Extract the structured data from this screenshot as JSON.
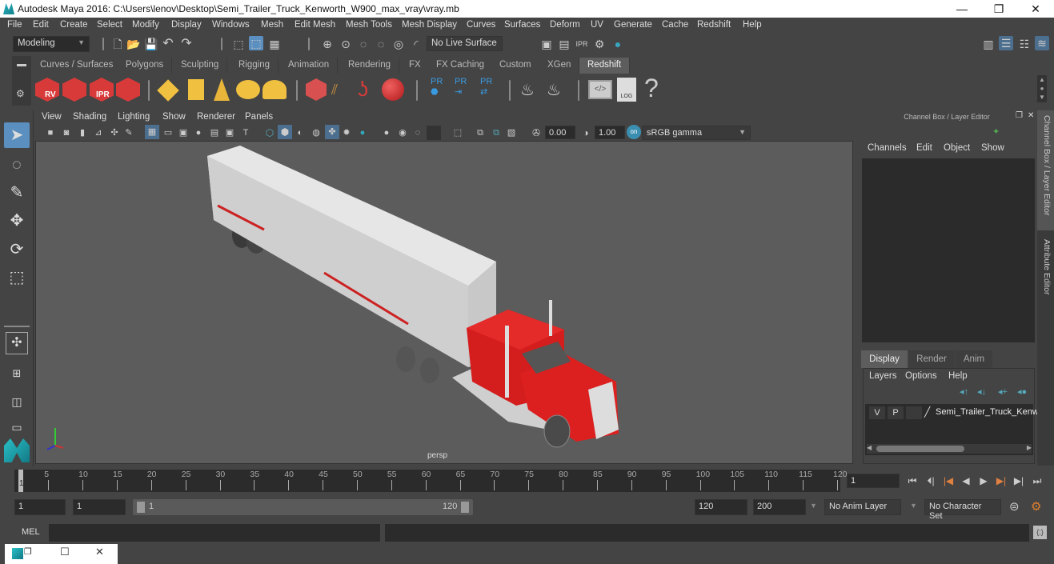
{
  "window": {
    "title": "Autodesk Maya 2016: C:\\Users\\lenov\\Desktop\\Semi_Trailer_Truck_Kenworth_W900_max_vray\\vray.mb",
    "minimize": "—",
    "restore": "❐",
    "close": "✕"
  },
  "menubar": [
    "File",
    "Edit",
    "Create",
    "Select",
    "Modify",
    "Display",
    "Windows",
    "Mesh",
    "Edit Mesh",
    "Mesh Tools",
    "Mesh Display",
    "Curves",
    "Surfaces",
    "Deform",
    "UV",
    "Generate",
    "Cache",
    "Redshift",
    "Help"
  ],
  "statusline": {
    "mode": "Modeling",
    "live_surface": "No Live Surface"
  },
  "shelf": {
    "tabs": [
      "Curves / Surfaces",
      "Polygons",
      "Sculpting",
      "Rigging",
      "Animation",
      "Rendering",
      "FX",
      "FX Caching",
      "Custom",
      "XGen",
      "Redshift"
    ],
    "active_tab": "Redshift",
    "icons": [
      {
        "name": "redshift-render-view-icon",
        "label": "RV"
      },
      {
        "name": "redshift-render-sequence-icon",
        "label": ""
      },
      {
        "name": "redshift-ipr-icon",
        "label": "IPR"
      },
      {
        "name": "redshift-settings-icon",
        "label": ""
      },
      {
        "name": "rs-light-diamond-icon",
        "label": ""
      },
      {
        "name": "rs-area-light-icon",
        "label": ""
      },
      {
        "name": "rs-spot-light-icon",
        "label": ""
      },
      {
        "name": "rs-dome-light-icon",
        "label": ""
      },
      {
        "name": "rs-sun-sky-icon",
        "label": ""
      },
      {
        "name": "rs-proxy-icon",
        "label": ""
      },
      {
        "name": "rs-hair-icon",
        "label": ""
      },
      {
        "name": "rs-volume-icon",
        "label": ""
      },
      {
        "name": "rs-material-sphere-icon",
        "label": ""
      },
      {
        "name": "pr-object-icon",
        "label": "PR"
      },
      {
        "name": "pr-export-icon",
        "label": "PR"
      },
      {
        "name": "pr-swap-icon",
        "label": "PR"
      },
      {
        "name": "bake-multiple-icon",
        "label": ""
      },
      {
        "name": "bake-single-icon",
        "label": ""
      },
      {
        "name": "script-editor-icon",
        "label": ""
      },
      {
        "name": "log-icon",
        "label": "LOG"
      },
      {
        "name": "help-icon",
        "label": "?"
      }
    ]
  },
  "viewport": {
    "menu": [
      "View",
      "Shading",
      "Lighting",
      "Show",
      "Renderer",
      "Panels"
    ],
    "exposure": "0.00",
    "gamma": "1.00",
    "color_space": "sRGB gamma",
    "camera_label": "persp"
  },
  "channel_box": {
    "title": "Channel Box / Layer Editor",
    "menu": [
      "Channels",
      "Edit",
      "Object",
      "Show"
    ],
    "layer_tabs": [
      "Display",
      "Render",
      "Anim"
    ],
    "active_layer_tab": "Display",
    "layer_menu": [
      "Layers",
      "Options",
      "Help"
    ],
    "layers": [
      {
        "v": "V",
        "p": "P",
        "name": "Semi_Trailer_Truck_Kenw"
      }
    ]
  },
  "side_tabs": [
    "Channel Box / Layer Editor",
    "Attribute Editor"
  ],
  "timeline": {
    "ticks": [
      5,
      10,
      15,
      20,
      25,
      30,
      35,
      40,
      45,
      50,
      55,
      60,
      65,
      70,
      75,
      80,
      85,
      90,
      95,
      100,
      105,
      110,
      115,
      120
    ],
    "current_frame_marker": "1",
    "current_frame": "1",
    "range_min": 1,
    "range_max": 120
  },
  "range": {
    "start": "1",
    "playback_start": "1",
    "slider_start": "1",
    "slider_end": "120",
    "playback_end": "120",
    "end": "200",
    "anim_layer": "No Anim Layer",
    "character_set": "No Character Set"
  },
  "command_line": {
    "label": "MEL",
    "value": ""
  },
  "colors": {
    "accent": "#5b8fbf",
    "truck_red": "#d81e1e",
    "trailer_white": "#d8d8d8",
    "viewport_bg": "#5c5c5c"
  }
}
